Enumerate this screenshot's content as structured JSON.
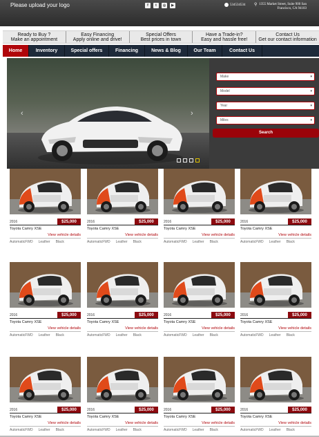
{
  "header": {
    "logo_text": "Please upload your logo",
    "social": [
      {
        "icon": "facebook-icon",
        "glyph": "f"
      },
      {
        "icon": "twitter-icon",
        "glyph": "t"
      },
      {
        "icon": "instagram-icon",
        "glyph": "◎"
      },
      {
        "icon": "youtube-icon",
        "glyph": "▶"
      }
    ],
    "phone": "534534534",
    "address": "1355 Market Street, Suite 900 San Francisco, CA 94103"
  },
  "promo": [
    {
      "title": "Ready to Buy ?",
      "subtitle": "Make an appointment"
    },
    {
      "title": "Easy Financing",
      "subtitle": "Apply online and drive!"
    },
    {
      "title": "Special Offers",
      "subtitle": "Best prices in town"
    },
    {
      "title": "Have a Trade-in?",
      "subtitle": "Easy and hassle free!"
    },
    {
      "title": "Contact Us",
      "subtitle": "Get our contact information"
    }
  ],
  "nav": [
    {
      "label": "Home",
      "active": true
    },
    {
      "label": "Inventory",
      "active": false
    },
    {
      "label": "Special offers",
      "active": false
    },
    {
      "label": "Financing",
      "active": false
    },
    {
      "label": "News & Blog",
      "active": false
    },
    {
      "label": "Our Team",
      "active": false
    },
    {
      "label": "Contact Us",
      "active": false
    }
  ],
  "hero": {
    "prev": "‹",
    "next": "›",
    "slides": 4,
    "active_slide": 4
  },
  "search": {
    "fields": [
      "Make",
      "Model",
      "Year",
      "Miles"
    ],
    "button": "Search"
  },
  "listings": [
    {
      "year": "2016",
      "price": "$25,000",
      "name": "Toyota Camry XSE",
      "details": "View vehicle details",
      "transmission": "Automatic",
      "drive": "FWD",
      "interior": "Leather",
      "color": "Black"
    },
    {
      "year": "2016",
      "price": "$25,000",
      "name": "Toyota Camry XSE",
      "details": "View vehicle details",
      "transmission": "Automatic",
      "drive": "FWD",
      "interior": "Leather",
      "color": "Black"
    },
    {
      "year": "2016",
      "price": "$25,000",
      "name": "Toyota Camry XSE",
      "details": "View vehicle details",
      "transmission": "Automatic",
      "drive": "FWD",
      "interior": "Leather",
      "color": "Black"
    },
    {
      "year": "2016",
      "price": "$25,000",
      "name": "Toyota Camry XSE",
      "details": "View vehicle details",
      "transmission": "Automatic",
      "drive": "FWD",
      "interior": "Leather",
      "color": "Black"
    },
    {
      "year": "2016",
      "price": "$25,000",
      "name": "Toyota Camry XSE",
      "details": "View vehicle details",
      "transmission": "Automatic",
      "drive": "FWD",
      "interior": "Leather",
      "color": "Black"
    },
    {
      "year": "2016",
      "price": "$25,000",
      "name": "Toyota Camry XSE",
      "details": "View vehicle details",
      "transmission": "Automatic",
      "drive": "FWD",
      "interior": "Leather",
      "color": "Black"
    },
    {
      "year": "2016",
      "price": "$25,000",
      "name": "Toyota Camry XSE",
      "details": "View vehicle details",
      "transmission": "Automatic",
      "drive": "FWD",
      "interior": "Leather",
      "color": "Black"
    },
    {
      "year": "2016",
      "price": "$25,000",
      "name": "Toyota Camry XSE",
      "details": "View vehicle details",
      "transmission": "Automatic",
      "drive": "FWD",
      "interior": "Leather",
      "color": "Black"
    },
    {
      "year": "2016",
      "price": "$25,000",
      "name": "Toyota Camry XSE",
      "details": "View vehicle details",
      "transmission": "Automatic",
      "drive": "FWD",
      "interior": "Leather",
      "color": "Black"
    },
    {
      "year": "2016",
      "price": "$25,000",
      "name": "Toyota Camry XSE",
      "details": "View vehicle details",
      "transmission": "Automatic",
      "drive": "FWD",
      "interior": "Leather",
      "color": "Black"
    },
    {
      "year": "2016",
      "price": "$25,000",
      "name": "Toyota Camry XSE",
      "details": "View vehicle details",
      "transmission": "Automatic",
      "drive": "FWD",
      "interior": "Leather",
      "color": "Black"
    },
    {
      "year": "2016",
      "price": "$25,000",
      "name": "Toyota Camry XSE",
      "details": "View vehicle details",
      "transmission": "Automatic",
      "drive": "FWD",
      "interior": "Leather",
      "color": "Black"
    }
  ],
  "colors": {
    "accent_red": "#b0050a",
    "nav_bg": "#1e2a3a",
    "header_bg": "#3a3a3a"
  }
}
